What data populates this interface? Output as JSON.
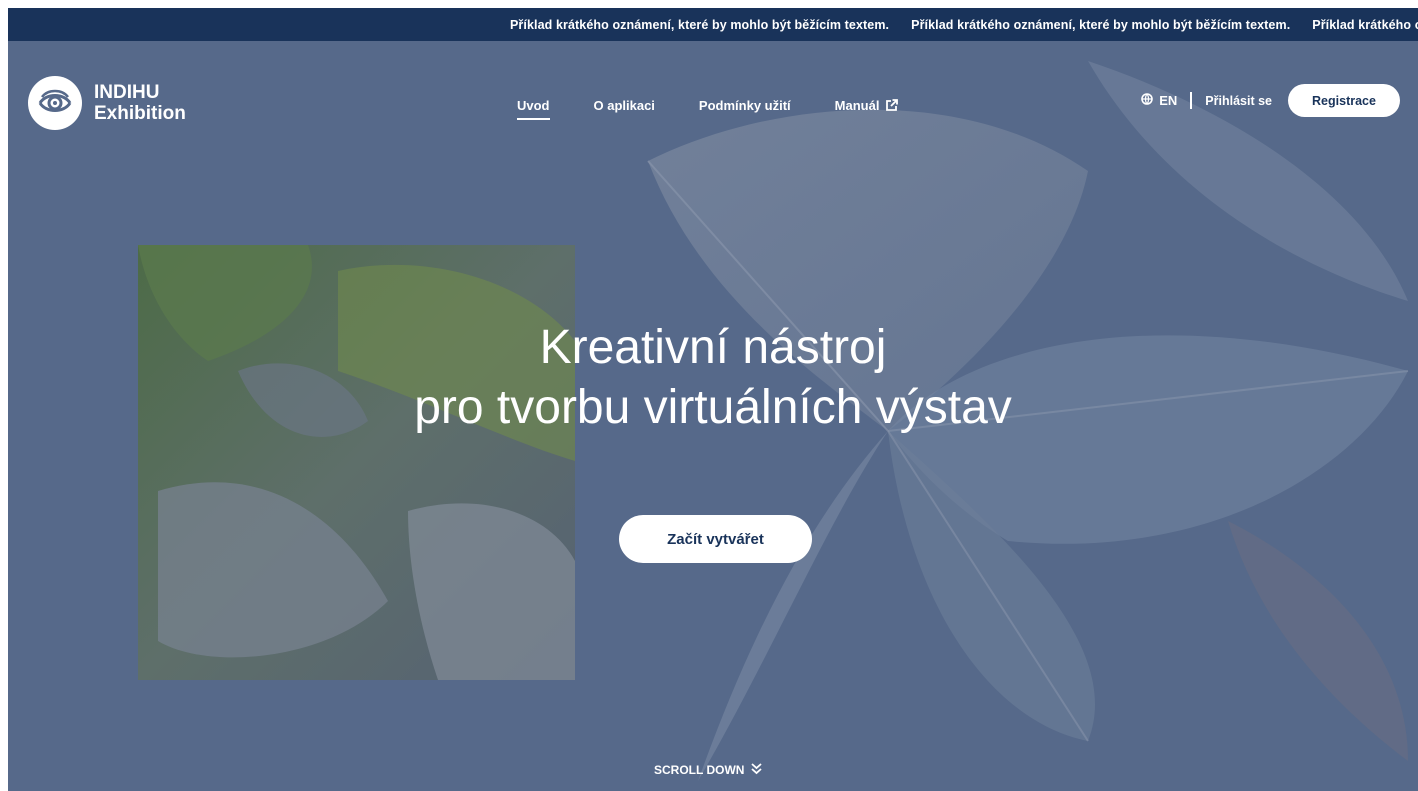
{
  "ticker": {
    "items": [
      "Příklad krátkého oznámení, které by mohlo být běžícím textem.",
      "Příklad krátkého oznámení, které by mohlo být běžícím textem.",
      "Příklad krátkého oznámení, které by mohlo být běžícím textem."
    ]
  },
  "header": {
    "logo_line1": "INDIHU",
    "logo_line2": "Exhibition",
    "nav": [
      {
        "label": "Uvod",
        "active": true
      },
      {
        "label": "O aplikaci",
        "active": false
      },
      {
        "label": "Podmínky užití",
        "active": false
      },
      {
        "label": "Manuál",
        "active": false,
        "icon": "external-link-icon"
      }
    ],
    "language": "EN",
    "login_label": "Přihlásit se",
    "register_label": "Registrace"
  },
  "hero": {
    "title_line1": "Kreativní nástroj",
    "title_line2": "pro tvorbu virtuálních výstav",
    "cta_label": "Začít vytvářet",
    "scroll_label": "SCROLL DOWN"
  },
  "colors": {
    "ticker_bg": "#19335a",
    "hero_overlay": "#56698a",
    "button_text": "#19335a"
  }
}
